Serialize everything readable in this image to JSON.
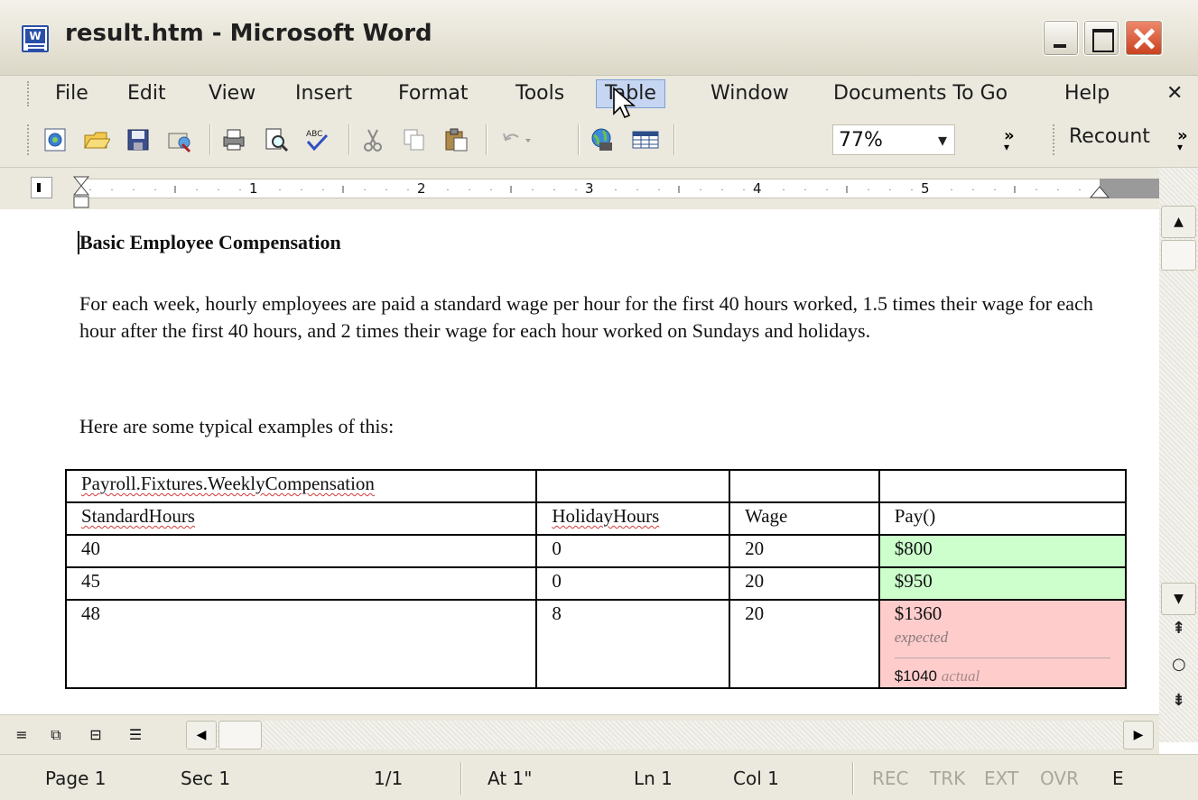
{
  "window": {
    "title": "result.htm - Microsoft Word",
    "app_icon": "word-doc-icon"
  },
  "menu": {
    "items": [
      "File",
      "Edit",
      "View",
      "Insert",
      "Format",
      "Tools",
      "Table",
      "Window",
      "Documents To Go",
      "Help"
    ],
    "active": "Table",
    "close_glyph": "✕"
  },
  "toolbar": {
    "icons": [
      "new-doc-icon",
      "open-folder-icon",
      "save-icon",
      "permission-icon",
      "print-icon",
      "print-preview-icon",
      "spelling-icon",
      "cut-icon",
      "copy-icon",
      "paste-icon",
      "undo-icon",
      "web-icon",
      "table-icon"
    ],
    "zoom": "77%",
    "more": "»",
    "recount": "Recount"
  },
  "ruler": {
    "numbers": [
      "1",
      "2",
      "3",
      "4",
      "5"
    ]
  },
  "document": {
    "heading": "Basic Employee Compensation",
    "paragraph1": "For each week, hourly employees are paid a standard wage per hour for the first 40 hours worked, 1.5 times their wage for each hour after the first 40 hours, and 2 times their wage for each hour worked on Sundays and holidays.",
    "paragraph2": "Here are some typical examples of this:",
    "table": {
      "fixture": "Payroll.Fixtures.WeeklyCompensation",
      "headers": [
        "StandardHours",
        "HolidayHours",
        "Wage",
        "Pay()"
      ],
      "rows": [
        {
          "standard": "40",
          "holiday": "0",
          "wage": "20",
          "pay": "$800",
          "status": "pass"
        },
        {
          "standard": "45",
          "holiday": "0",
          "wage": "20",
          "pay": "$950",
          "status": "pass"
        },
        {
          "standard": "48",
          "holiday": "8",
          "wage": "20",
          "pay": "$1360",
          "status": "fail",
          "expected_label": "expected",
          "actual": "$1040",
          "actual_label": "actual"
        }
      ]
    }
  },
  "status": {
    "page": "Page  1",
    "sec": "Sec  1",
    "pages": "1/1",
    "at": "At  1\"",
    "ln": "Ln  1",
    "col": "Col  1",
    "rec": "REC",
    "trk": "TRK",
    "ext": "EXT",
    "ovr": "OVR",
    "lang": "E"
  },
  "colors": {
    "pass": "#ccffcc",
    "fail": "#ffcccc",
    "close_button": "#d4502c"
  }
}
